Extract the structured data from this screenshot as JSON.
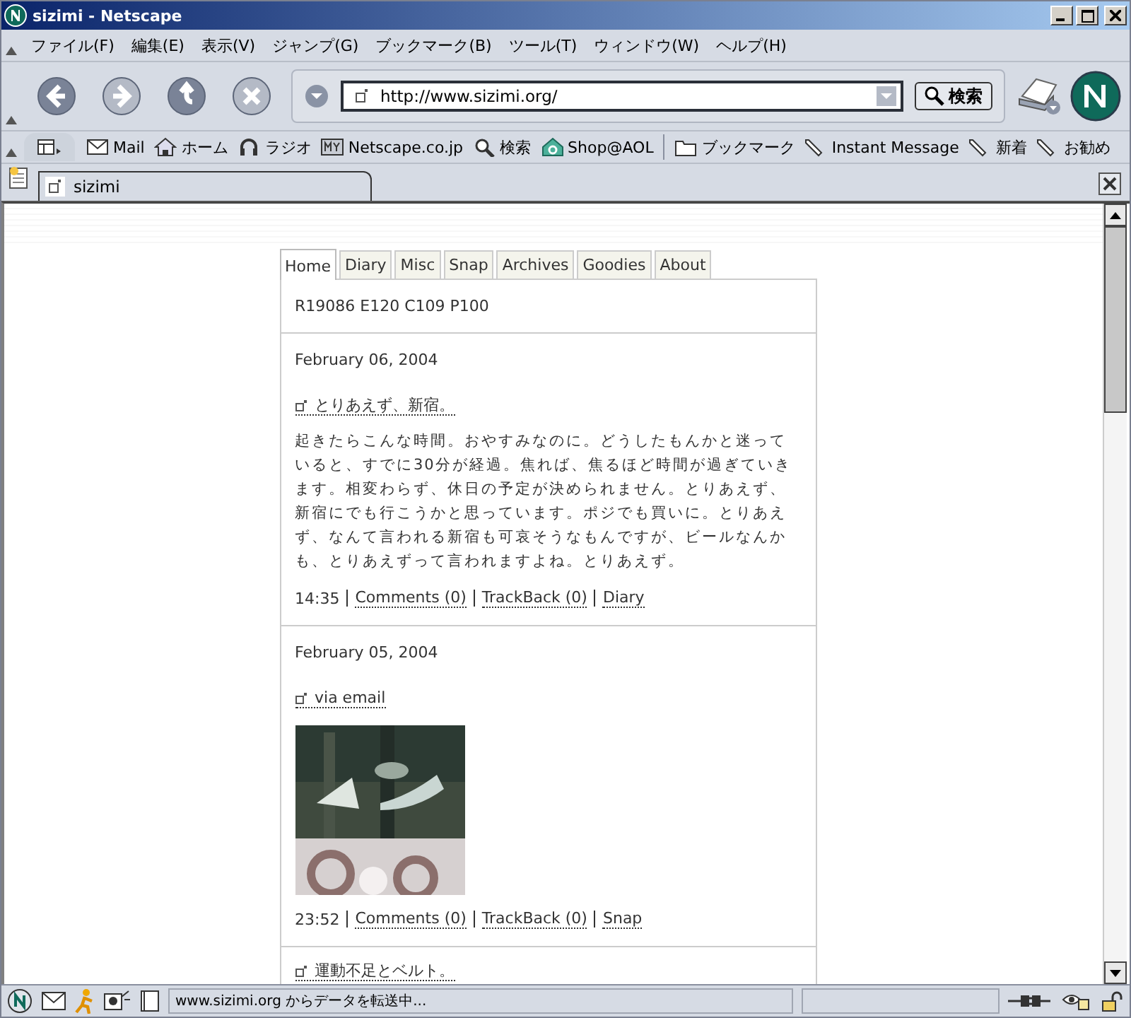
{
  "window": {
    "title": "sizimi - Netscape"
  },
  "menu": [
    "ファイル(F)",
    "編集(E)",
    "表示(V)",
    "ジャンプ(G)",
    "ブックマーク(B)",
    "ツール(T)",
    "ウィンドウ(W)",
    "ヘルプ(H)"
  ],
  "nav_buttons": [
    {
      "kind": "back",
      "disabled": false
    },
    {
      "kind": "forward",
      "disabled": true
    },
    {
      "kind": "reload",
      "disabled": false
    },
    {
      "kind": "stop",
      "disabled": true
    }
  ],
  "url_field": {
    "value": "http://www.sizimi.org/"
  },
  "search_button": "検索",
  "personal_toolbar": [
    {
      "kind": "mail",
      "label": "Mail"
    },
    {
      "kind": "home",
      "label": "ホーム"
    },
    {
      "kind": "radio",
      "label": "ラジオ"
    },
    {
      "kind": "my",
      "label": "Netscape.co.jp"
    },
    {
      "kind": "search",
      "label": "検索"
    },
    {
      "kind": "shop",
      "label": "Shop@AOL"
    },
    {
      "kind": "folder",
      "label": "ブックマーク"
    },
    {
      "kind": "bookmark",
      "label": "Instant Message"
    },
    {
      "kind": "bookmark",
      "label": "新着"
    },
    {
      "kind": "bookmark",
      "label": "お勧め"
    }
  ],
  "browser_tabs": [
    {
      "label": "sizimi",
      "selected": true
    }
  ],
  "site_tabs": [
    {
      "label": "Home",
      "selected": true
    },
    {
      "label": "Diary",
      "selected": false
    },
    {
      "label": "Misc",
      "selected": false
    },
    {
      "label": "Snap",
      "selected": false
    },
    {
      "label": "Archives",
      "selected": false
    },
    {
      "label": "Goodies",
      "selected": false
    },
    {
      "label": "About",
      "selected": false
    }
  ],
  "stats": "R19086 E120 C109 P100",
  "entries": [
    {
      "date": "February 06, 2004",
      "title": "とりあえず、新宿。",
      "kind": "text",
      "body": "起きたらこんな時間。おやすみなのに。どうしたもんかと迷っていると、すでに30分が経過。焦れば、焦るほど時間が過ぎていきます。相変わらず、休日の予定が決められません。とりあえず、新宿にでも行こうかと思っています。ポジでも買いに。とりあえず、なんて言われる新宿も可哀そうなもんですが、ビールなんかも、とりあえずって言われますよね。とりあえず。",
      "time": "14:35",
      "links": [
        "Comments (0)",
        "TrackBack (0)",
        "Diary"
      ]
    },
    {
      "date": "February 05, 2004",
      "title": "via email",
      "time": "23:52",
      "links": [
        "Comments (0)",
        "TrackBack (0)",
        "Snap"
      ]
    },
    {
      "title": "運動不足とベルト。",
      "kind": "partial"
    }
  ],
  "status_bar": "www.sizimi.org からデータを転送中..."
}
